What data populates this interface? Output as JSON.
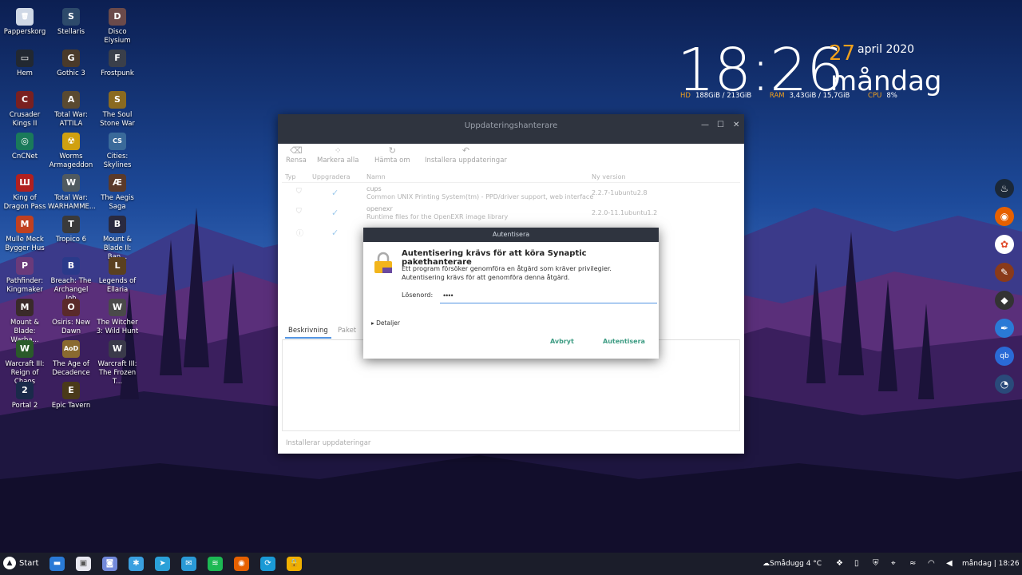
{
  "desktop_icons": [
    {
      "label": "Papperskorg",
      "icon": "trash-icon",
      "color": "#cfd8e6",
      "glyph": "🗑"
    },
    {
      "label": "Stellaris",
      "icon": "stellaris-icon",
      "color": "#2d4a6b",
      "glyph": "S"
    },
    {
      "label": "Disco Elysium",
      "icon": "disco-elysium-icon",
      "color": "#6b4a4a",
      "glyph": "D"
    },
    {
      "label": "Hem",
      "icon": "home-monitor-icon",
      "color": "#222831",
      "glyph": "▭"
    },
    {
      "label": "Gothic 3",
      "icon": "gothic-icon",
      "color": "#4a3a2a",
      "glyph": "G"
    },
    {
      "label": "Frostpunk",
      "icon": "frostpunk-icon",
      "color": "#3a3f4a",
      "glyph": "F"
    },
    {
      "label": "Crusader Kings II",
      "icon": "crusader-kings-icon",
      "color": "#7a2020",
      "glyph": "C"
    },
    {
      "label": "Total War: ATTILA",
      "icon": "total-war-icon",
      "color": "#5a4a30",
      "glyph": "A"
    },
    {
      "label": "The Soul Stone War",
      "icon": "soul-stone-icon",
      "color": "#8a6a20",
      "glyph": "S"
    },
    {
      "label": "CnCNet",
      "icon": "cncnet-icon",
      "color": "#1a7a5a",
      "glyph": "◎"
    },
    {
      "label": "Worms Armageddon",
      "icon": "worms-icon",
      "color": "#d0a010",
      "glyph": "☢"
    },
    {
      "label": "Cities: Skylines",
      "icon": "cities-skylines-icon",
      "color": "#3a6a9a",
      "glyph": "CS"
    },
    {
      "label": "King of Dragon Pass",
      "icon": "dragon-pass-icon",
      "color": "#b02020",
      "glyph": "Ш"
    },
    {
      "label": "Total War: WARHAMME...",
      "icon": "warhammer-icon",
      "color": "#505a60",
      "glyph": "W"
    },
    {
      "label": "The Aegis Saga",
      "icon": "aegis-saga-icon",
      "color": "#5a3a2a",
      "glyph": "Æ"
    },
    {
      "label": "Mulle Meck Bygger Hus",
      "icon": "mulle-meck-icon",
      "color": "#c04020",
      "glyph": "M"
    },
    {
      "label": "Tropico 6",
      "icon": "tropico-icon",
      "color": "#3a3a3a",
      "glyph": "T"
    },
    {
      "label": "Mount & Blade II: Ban...",
      "icon": "bannerlord-icon",
      "color": "#2a2a40",
      "glyph": "B"
    },
    {
      "label": "Pathfinder: Kingmaker",
      "icon": "pathfinder-icon",
      "color": "#6a3a7a",
      "glyph": "P"
    },
    {
      "label": "Breach: The Archangel Job",
      "icon": "breach-icon",
      "color": "#2a3a8a",
      "glyph": "B"
    },
    {
      "label": "Legends of Ellaria",
      "icon": "ellaria-icon",
      "color": "#5a4020",
      "glyph": "L"
    },
    {
      "label": "Mount & Blade: Warba...",
      "icon": "warband-icon",
      "color": "#3a2a2a",
      "glyph": "M"
    },
    {
      "label": "Osiris: New Dawn",
      "icon": "osiris-icon",
      "color": "#5a2a2a",
      "glyph": "O"
    },
    {
      "label": "The Witcher 3: Wild Hunt",
      "icon": "witcher-icon",
      "color": "#4a4a4a",
      "glyph": "W"
    },
    {
      "label": "Warcraft III: Reign of Chaos",
      "icon": "warcraft-icon",
      "color": "#2a5a2a",
      "glyph": "W"
    },
    {
      "label": "The Age of Decadence",
      "icon": "decadence-icon",
      "color": "#8a6a30",
      "glyph": "AoD"
    },
    {
      "label": "Warcraft III: The Frozen T...",
      "icon": "frozen-throne-icon",
      "color": "#3a3a4a",
      "glyph": "W"
    },
    {
      "label": "Portal 2",
      "icon": "portal-icon",
      "color": "#1a2a4a",
      "glyph": "2"
    },
    {
      "label": "Epic Tavern",
      "icon": "epic-tavern-icon",
      "color": "#4a3a1a",
      "glyph": "E"
    }
  ],
  "clock": {
    "time": "18:26",
    "day": "27",
    "month_year": "april 2020",
    "weekday": "måndag"
  },
  "stats": {
    "hd_label": "HD",
    "hd_value": "188GiB / 213GiB",
    "ram_label": "RAM",
    "ram_value": "3,43GiB / 15,7GiB",
    "cpu_label": "CPU",
    "cpu_value": "8%"
  },
  "window": {
    "title": "Uppdateringshanterare",
    "toolbar": {
      "clear": "Rensa",
      "select_all": "Markera alla",
      "fetch": "Hämta om",
      "install": "Installera uppdateringar"
    },
    "columns": {
      "type": "Typ",
      "upgrade": "Uppgradera",
      "name": "Namn",
      "new_version": "Ny version"
    },
    "rows": [
      {
        "name": "cups",
        "desc": "Common UNIX Printing System(tm) - PPD/driver support, web interface",
        "version": "2.2.7-1ubuntu2.8",
        "type_icon": "shield-icon"
      },
      {
        "name": "openexr",
        "desc": "Runtime files for the OpenEXR image library",
        "version": "2.2.0-11.1ubuntu1.2",
        "type_icon": "shield-icon"
      },
      {
        "name": "",
        "desc": "",
        "version": "",
        "type_icon": "info-icon"
      }
    ],
    "tabs": {
      "description": "Beskrivning",
      "package": "Paket"
    },
    "status": "Installerar uppdateringar"
  },
  "auth": {
    "title": "Autentisera",
    "heading": "Autentisering krävs för att köra Synaptic pakethanterare",
    "message_line1": "Ett program försöker genomföra en åtgärd som kräver privilegier.",
    "message_line2": "Autentisering krävs för att genomföra denna åtgärd.",
    "password_label": "Lösenord:",
    "password_value": "••••",
    "details": "Detaljer",
    "cancel": "Avbryt",
    "authenticate": "Autentisera"
  },
  "right_dock": [
    {
      "icon": "steam-icon",
      "color": "#1b2838",
      "glyph": "♨"
    },
    {
      "icon": "firefox-icon",
      "color": "#e66000",
      "glyph": "◉"
    },
    {
      "icon": "photos-icon",
      "color": "#ffffff",
      "glyph": "✿"
    },
    {
      "icon": "paint-icon",
      "color": "#8a3a1a",
      "glyph": "✎"
    },
    {
      "icon": "inkscape-icon",
      "color": "#333333",
      "glyph": "◆"
    },
    {
      "icon": "feather-icon",
      "color": "#2a7ad6",
      "glyph": "✒"
    },
    {
      "icon": "qbittorrent-icon",
      "color": "#2a6ad6",
      "glyph": "qb"
    },
    {
      "icon": "disk-usage-icon",
      "color": "#2a4a7a",
      "glyph": "◔"
    }
  ],
  "taskbar": {
    "start": "Start",
    "apps": [
      {
        "icon": "files-icon",
        "color": "#2a7ad6",
        "glyph": "▬"
      },
      {
        "icon": "store-icon",
        "color": "#e8e8f0",
        "glyph": "▣"
      },
      {
        "icon": "discord-icon",
        "color": "#7289da",
        "glyph": "◙"
      },
      {
        "icon": "slack-icon",
        "color": "#3aa0e0",
        "glyph": "✱"
      },
      {
        "icon": "telegram-icon",
        "color": "#2aa0d8",
        "glyph": "➤"
      },
      {
        "icon": "mail-icon",
        "color": "#2a9ad6",
        "glyph": "✉"
      },
      {
        "icon": "spotify-icon",
        "color": "#1db954",
        "glyph": "≋"
      },
      {
        "icon": "firefox-icon",
        "color": "#e66000",
        "glyph": "◉"
      },
      {
        "icon": "sync-icon",
        "color": "#1a9ad6",
        "glyph": "⟳"
      },
      {
        "icon": "lock-icon",
        "color": "#f0b000",
        "glyph": "🔒"
      }
    ],
    "weather": "Smådugg 4 °C",
    "clock": "måndag | 18:26",
    "tray": [
      "dropbox-icon",
      "usb-icon",
      "shield-icon",
      "location-icon",
      "rss-icon",
      "wifi-icon",
      "volume-icon"
    ]
  }
}
